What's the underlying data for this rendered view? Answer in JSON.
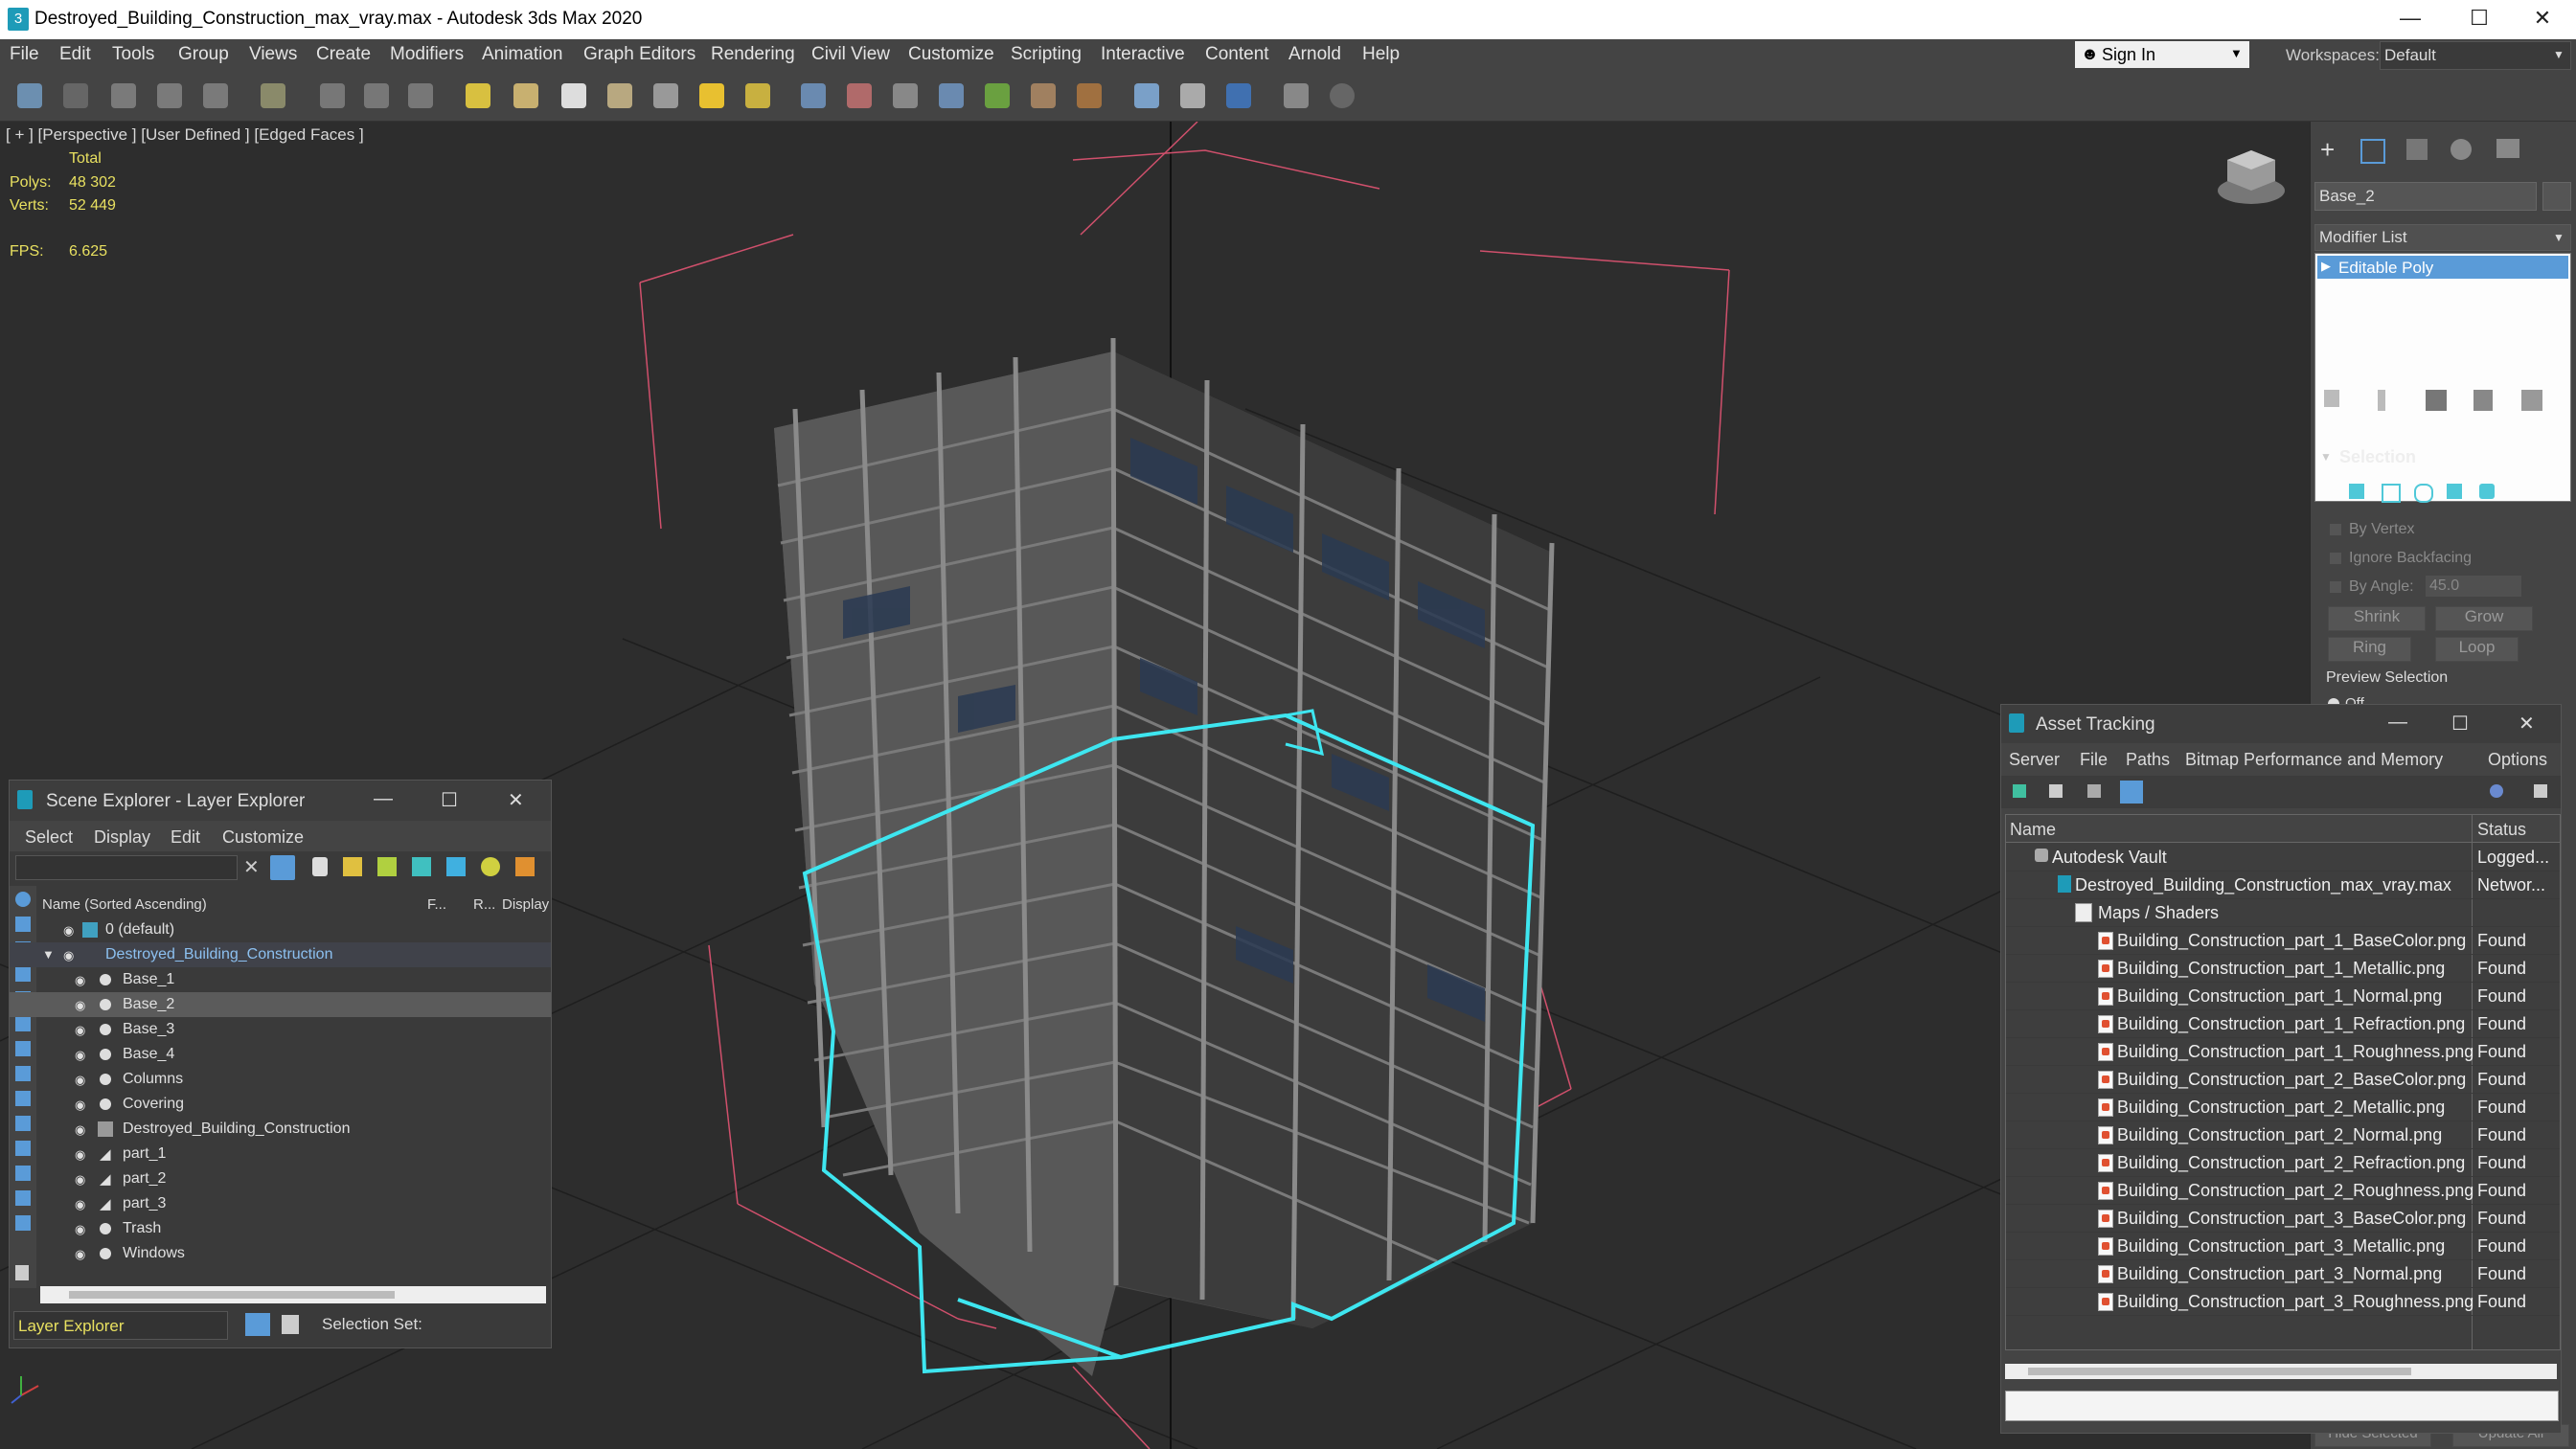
{
  "title_bar": {
    "title": "Destroyed_Building_Construction_max_vray.max - Autodesk 3ds Max 2020",
    "logo": "3",
    "minimize": "—",
    "maximize": "☐",
    "close": "✕"
  },
  "menu": [
    "File",
    "Edit",
    "Tools",
    "Group",
    "Views",
    "Create",
    "Modifiers",
    "Animation",
    "Graph Editors",
    "Rendering",
    "Civil View",
    "Customize",
    "Scripting",
    "Interactive",
    "Content",
    "Arnold",
    "Help"
  ],
  "signin": {
    "label": "Sign In"
  },
  "workspaces": {
    "label": "Workspaces:",
    "value": "Default"
  },
  "viewport": {
    "label": "[ + ] [Perspective ] [User Defined ] [Edged Faces ]",
    "stats": {
      "total": "Total",
      "polys_label": "Polys:",
      "polys_value": "48 302",
      "verts_label": "Verts:",
      "verts_value": "52 449",
      "fps_label": "FPS:",
      "fps_value": "6.625"
    }
  },
  "command_panel": {
    "object_name": "Base_2",
    "modifier_list": "Modifier List",
    "stack_item": "Editable Poly",
    "selection_title": "Selection",
    "by_vertex": "By Vertex",
    "ignore_backfacing": "Ignore Backfacing",
    "by_angle": "By Angle:",
    "by_angle_value": "45.0",
    "shrink": "Shrink",
    "grow": "Grow",
    "ring": "Ring",
    "loop": "Loop",
    "preview_selection": "Preview Selection",
    "off": "Off",
    "hide_selected": "Hide Selected",
    "update_all": "Update All"
  },
  "scene_explorer": {
    "title": "Scene Explorer - Layer Explorer",
    "menu": [
      "Select",
      "Display",
      "Edit",
      "Customize"
    ],
    "col_name": "Name (Sorted Ascending)",
    "col_f": "F...",
    "col_r": "R...",
    "col_display": "Display",
    "rows": [
      {
        "label": "0 (default)"
      },
      {
        "label": "Destroyed_Building_Construction"
      },
      {
        "label": "Base_1"
      },
      {
        "label": "Base_2"
      },
      {
        "label": "Base_3"
      },
      {
        "label": "Base_4"
      },
      {
        "label": "Columns"
      },
      {
        "label": "Covering"
      },
      {
        "label": "Destroyed_Building_Construction"
      },
      {
        "label": "part_1"
      },
      {
        "label": "part_2"
      },
      {
        "label": "part_3"
      },
      {
        "label": "Trash"
      },
      {
        "label": "Windows"
      }
    ],
    "footer_layer": "Layer Explorer",
    "selection_set": "Selection Set:"
  },
  "asset_tracking": {
    "title": "Asset Tracking",
    "menu": [
      "Server",
      "File",
      "Paths",
      "Bitmap Performance and Memory",
      "Options"
    ],
    "col_name": "Name",
    "col_status": "Status",
    "rows": [
      {
        "name": "Autodesk Vault",
        "status": "Logged..."
      },
      {
        "name": "Destroyed_Building_Construction_max_vray.max",
        "status": "Networ..."
      },
      {
        "name": "Maps / Shaders",
        "status": ""
      },
      {
        "name": "Building_Construction_part_1_BaseColor.png",
        "status": "Found"
      },
      {
        "name": "Building_Construction_part_1_Metallic.png",
        "status": "Found"
      },
      {
        "name": "Building_Construction_part_1_Normal.png",
        "status": "Found"
      },
      {
        "name": "Building_Construction_part_1_Refraction.png",
        "status": "Found"
      },
      {
        "name": "Building_Construction_part_1_Roughness.png",
        "status": "Found"
      },
      {
        "name": "Building_Construction_part_2_BaseColor.png",
        "status": "Found"
      },
      {
        "name": "Building_Construction_part_2_Metallic.png",
        "status": "Found"
      },
      {
        "name": "Building_Construction_part_2_Normal.png",
        "status": "Found"
      },
      {
        "name": "Building_Construction_part_2_Refraction.png",
        "status": "Found"
      },
      {
        "name": "Building_Construction_part_2_Roughness.png",
        "status": "Found"
      },
      {
        "name": "Building_Construction_part_3_BaseColor.png",
        "status": "Found"
      },
      {
        "name": "Building_Construction_part_3_Metallic.png",
        "status": "Found"
      },
      {
        "name": "Building_Construction_part_3_Normal.png",
        "status": "Found"
      },
      {
        "name": "Building_Construction_part_3_Roughness.png",
        "status": "Found"
      }
    ]
  },
  "colors": {
    "selection_cyan": "#3ee6f0",
    "accent_blue": "#5a9bd8",
    "stat_yellow": "#e8e060",
    "bbox_pink": "#d0506c"
  }
}
